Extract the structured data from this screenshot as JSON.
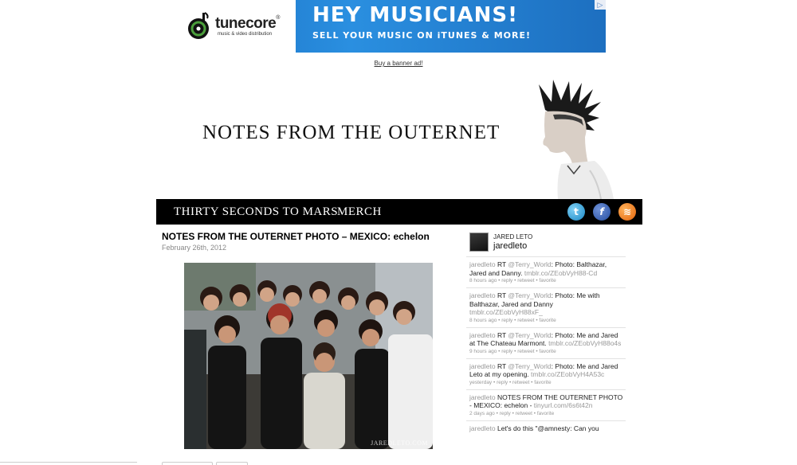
{
  "banner": {
    "brand": "tunecore",
    "brand_suffix": "®",
    "brand_sub": "music & video distribution",
    "headline": "HEY MUSICIANS!",
    "tagline": "SELL YOUR MUSIC ON iTUNES & MORE!",
    "adchoice": "▷",
    "buy_link": "Buy a banner ad!"
  },
  "header": {
    "site_title": "NOTES FROM THE OUTERNET"
  },
  "nav": {
    "items": [
      {
        "label": "THIRTY SECONDS TO MARS"
      },
      {
        "label": "MERCH"
      }
    ],
    "social": {
      "twitter": "t",
      "facebook": "f",
      "rss": "≋"
    }
  },
  "post": {
    "title": "NOTES FROM THE OUTERNET PHOTO – MEXICO: echelon",
    "date": "February 26th, 2012",
    "watermark": "JAREDLETO.COM"
  },
  "twitter": {
    "name": "JARED LETO",
    "handle": "jaredleto",
    "tweets": [
      {
        "user": "jaredleto",
        "rt": "RT ",
        "mention": "@Terry_World",
        "text": ": Photo: Balthazar, Jared and Danny. ",
        "link": "tmblr.co/ZEobVyH88-Cd",
        "meta": "8 hours ago • reply • retweet • favorite"
      },
      {
        "user": "jaredleto",
        "rt": "RT ",
        "mention": "@Terry_World",
        "text": ": Photo: Me with Balthazar, Jared and Danny ",
        "link": "tmblr.co/ZEobVyH88xF_",
        "meta": "8 hours ago • reply • retweet • favorite"
      },
      {
        "user": "jaredleto",
        "rt": "RT ",
        "mention": "@Terry_World",
        "text": ": Photo: Me and Jared at The Chateau Marmont. ",
        "link": "tmblr.co/ZEobVyH88o4s",
        "meta": "9 hours ago • reply • retweet • favorite"
      },
      {
        "user": "jaredleto",
        "rt": "RT ",
        "mention": "@Terry_World",
        "text": ": Photo: Me and Jared Leto at my opening. ",
        "link": "tmblr.co/ZEobVyH4A53c",
        "meta": "yesterday • reply • retweet • favorite"
      },
      {
        "user": "jaredleto",
        "rt": " ",
        "mention": "",
        "text": "NOTES FROM THE OUTERNET PHOTO - MEXICO: echelon - ",
        "link": "tinyurl.com/6s6t42n",
        "meta": "2 days ago • reply • retweet • favorite"
      },
      {
        "user": "jaredleto",
        "rt": " ",
        "mention": "",
        "text": "Let's do this \"@amnesty: Can you",
        "link": "",
        "meta": ""
      }
    ]
  }
}
